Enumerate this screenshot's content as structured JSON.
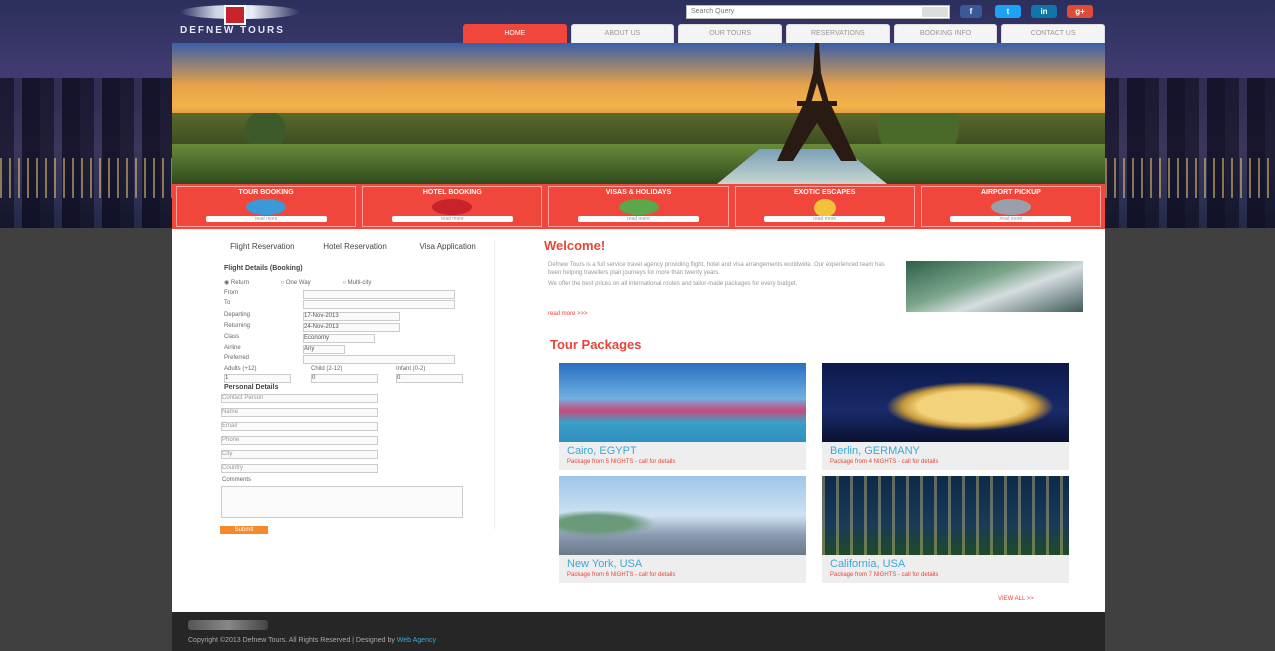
{
  "brand": {
    "name": "DEFNEW TOURS"
  },
  "search": {
    "placeholder": "Search Query"
  },
  "social": [
    {
      "icon": "facebook-icon",
      "glyph": "f",
      "color": "#3b5998"
    },
    {
      "icon": "twitter-icon",
      "glyph": "t",
      "color": "#1da1f2"
    },
    {
      "icon": "linkedin-icon",
      "glyph": "in",
      "color": "#0e76a8"
    },
    {
      "icon": "googleplus-icon",
      "glyph": "g+",
      "color": "#dd4b39"
    }
  ],
  "nav": {
    "items": [
      "HOME",
      "ABOUT US",
      "OUR TOURS",
      "RESERVATIONS",
      "BOOKING INFO",
      "CONTACT US"
    ]
  },
  "services": [
    {
      "title": "TOUR BOOKING",
      "button": "read more",
      "icon_color": "#3a9ad9"
    },
    {
      "title": "HOTEL BOOKING",
      "button": "read more",
      "icon_color": "#c8232c"
    },
    {
      "title": "VISAS & HOLIDAYS",
      "button": "read more",
      "icon_color": "#5aa84a"
    },
    {
      "title": "EXOTIC ESCAPES",
      "button": "read more",
      "icon_color": "#f2c23a"
    },
    {
      "title": "AIRPORT PICKUP",
      "button": "read more",
      "icon_color": "#9aa0aa"
    }
  ],
  "form": {
    "tabs": [
      "Flight Reservation",
      "Hotel Reservation",
      "Visa Application"
    ],
    "title": "Flight Details (Booking)",
    "trip_return": "Return",
    "trip_oneway": "One Way",
    "trip_multi": "Multi-city",
    "from_label": "From",
    "to_label": "To",
    "departing_label": "Departing",
    "departing_value": "17-Nov-2013",
    "returning_label": "Returning",
    "returning_value": "24-Nov-2013",
    "class_label": "Class",
    "class_value": "Economy",
    "airline_label": "Airline",
    "airline_value": "Any",
    "preferred_label": "Preferred",
    "adults_label": "Adults (+12)",
    "children_label": "Child (2-12)",
    "infants_label": "Infant (0-2)",
    "adults_value": "1",
    "children_value": "0",
    "infants_value": "0",
    "personal_title": "Personal Details",
    "fields": [
      "Contact Person",
      "Name",
      "Email",
      "Phone",
      "City",
      "Country"
    ],
    "comments_label": "Comments",
    "submit": "Submit"
  },
  "welcome": {
    "title": "Welcome!",
    "para1": "Defnew Tours is a full service travel agency providing flight, hotel and visa arrangements worldwide. Our experienced team has been helping travellers plan journeys for more than twenty years.",
    "para2": "We offer the best prices on all international routes and tailor-made packages for every budget.",
    "more": "read more >>>"
  },
  "packages": {
    "title": "Tour Packages",
    "items": [
      {
        "name": "Cairo, EGYPT",
        "price": "Package from 5 NIGHTS - call for details"
      },
      {
        "name": "Berlin, GERMANY",
        "price": "Package from 4 NIGHTS - call for details"
      },
      {
        "name": "New York, USA",
        "price": "Package from 6 NIGHTS - call for details"
      },
      {
        "name": "California, USA",
        "price": "Package from 7 NIGHTS - call for details"
      }
    ],
    "view_all": "VIEW ALL >>"
  },
  "footer": {
    "copyright": "Copyright ©2013 Defnew Tours. All Rights Reserved | Designed by",
    "designer": "Web Agency"
  }
}
